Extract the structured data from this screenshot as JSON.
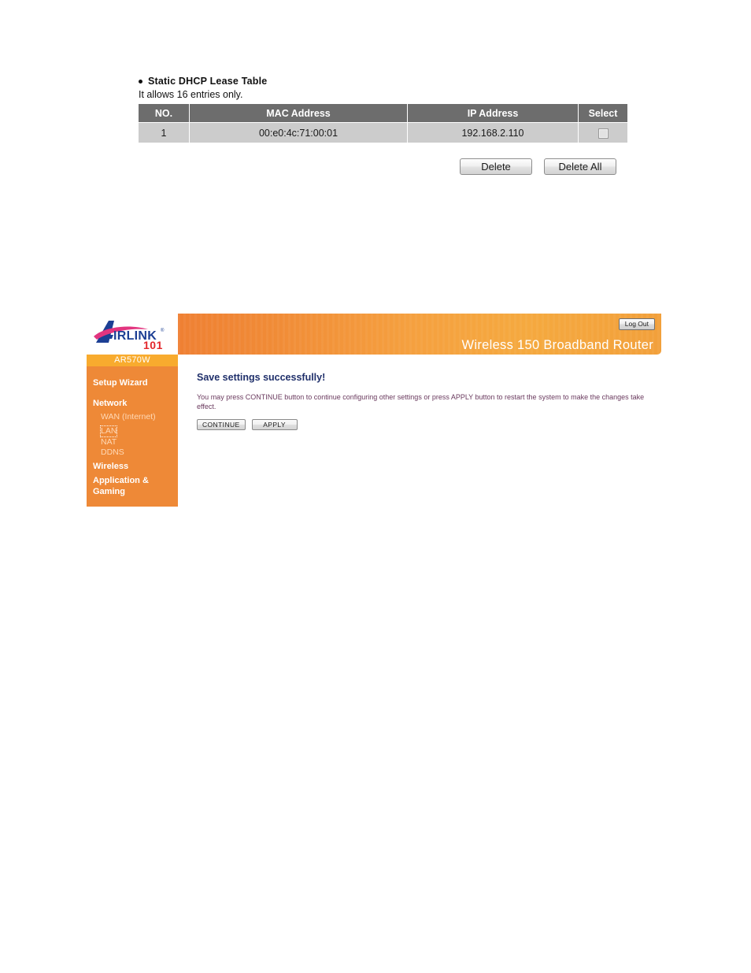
{
  "doc_section": {
    "heading": "Static DHCP Lease Table",
    "note": "It allows 16 entries only.",
    "table": {
      "columns": [
        "NO.",
        "MAC Address",
        "IP Address",
        "Select"
      ],
      "rows": [
        {
          "no": "1",
          "mac": "00:e0:4c:71:00:01",
          "ip": "192.168.2.110",
          "selected": false
        }
      ]
    },
    "buttons": {
      "delete": "Delete",
      "delete_all": "Delete All"
    }
  },
  "router_ui": {
    "logo": {
      "brand": "AIRLINK",
      "brand_lead": "A",
      "brand_rest": "IRLINK",
      "registered": "®",
      "number": "101",
      "model": "AR570W"
    },
    "header": {
      "product_title": "Wireless 150 Broadband Router",
      "logout_label": "Log Out"
    },
    "sidebar": {
      "model": "AR570W",
      "items": [
        {
          "label": "Setup Wizard",
          "level": "top"
        },
        {
          "label": "Network",
          "level": "top"
        },
        {
          "label": "WAN (Internet)",
          "level": "sub"
        },
        {
          "label": "LAN",
          "level": "sub",
          "focused": true
        },
        {
          "label": "NAT",
          "level": "sub"
        },
        {
          "label": "DDNS",
          "level": "sub"
        },
        {
          "label": "Wireless",
          "level": "top"
        },
        {
          "label": "Application & Gaming",
          "level": "top"
        }
      ]
    },
    "content": {
      "heading": "Save settings successfully!",
      "message": "You may press CONTINUE button to continue configuring other settings or press APPLY button to restart the system to make the changes take effect.",
      "continue_label": "CONTINUE",
      "apply_label": "APPLY"
    }
  },
  "colors": {
    "table_header_bg": "#6d6d6d",
    "table_row_bg": "#cccccc",
    "sidebar_bg": "#ee8937",
    "model_bar_bg": "#f8ab2e",
    "banner_orange": "#f5a03f",
    "heading_navy": "#20306b",
    "message_plum": "#6a3a5e",
    "logo_blue": "#1c3f94",
    "logo_pink": "#e2357f",
    "logo_red": "#e3262b"
  }
}
